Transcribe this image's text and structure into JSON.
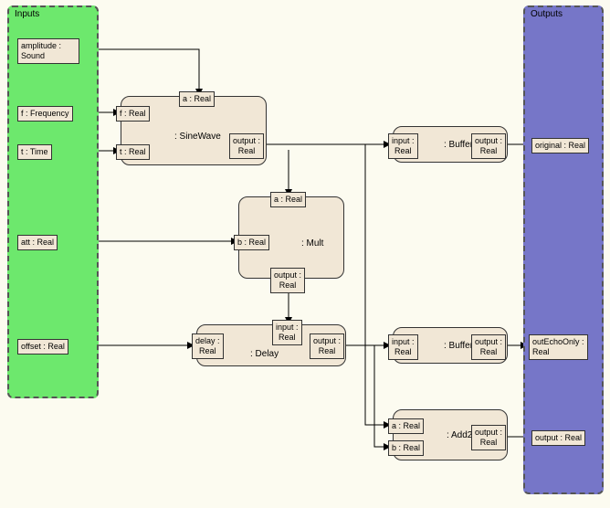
{
  "panels": {
    "inputs": {
      "title": "Inputs"
    },
    "outputs": {
      "title": "Outputs"
    }
  },
  "inputs": {
    "amplitude": "amplitude :\nSound",
    "f": "f : Frequency",
    "t": "t : Time",
    "att": "att : Real",
    "offset": "offset : Real"
  },
  "outputs": {
    "original": "original : Real",
    "outEchoOnly": "outEchoOnly :\nReal",
    "output": "output : Real"
  },
  "blocks": {
    "sinewave": {
      "label": ": SineWave",
      "ports": {
        "f": "f : Real",
        "t": "t : Real",
        "a": "a : Real",
        "output": "output :\nReal"
      }
    },
    "mult": {
      "label": ": Mult",
      "ports": {
        "a": "a : Real",
        "b": "b : Real",
        "output": "output :\nReal"
      }
    },
    "delay": {
      "label": ": Delay",
      "ports": {
        "delay": "delay :\nReal",
        "input": "input :\nReal",
        "output": "output :\nReal"
      }
    },
    "buffer1": {
      "label": ": Buffer",
      "ports": {
        "input": "input :\nReal",
        "output": "output :\nReal"
      }
    },
    "buffer2": {
      "label": ": Buffer",
      "ports": {
        "input": "input :\nReal",
        "output": "output :\nReal"
      }
    },
    "add2": {
      "label": ": Add2",
      "ports": {
        "a": "a : Real",
        "b": "b : Real",
        "output": "output :\nReal"
      }
    }
  }
}
